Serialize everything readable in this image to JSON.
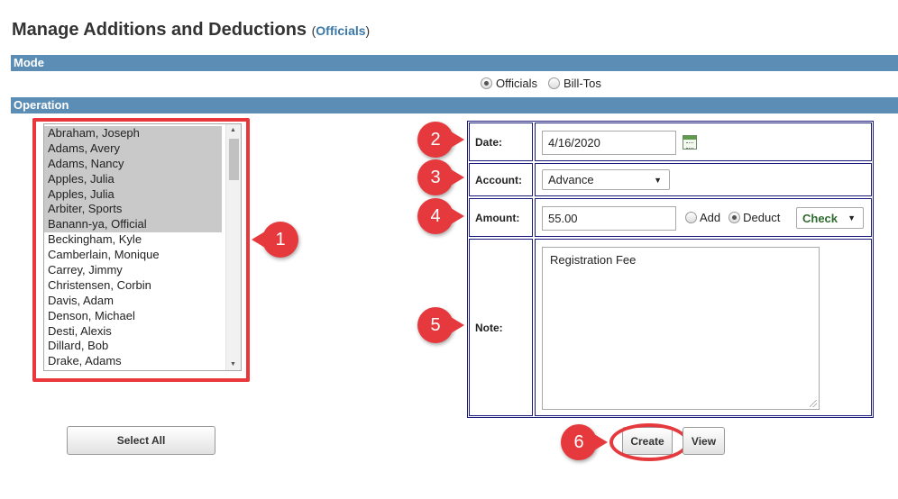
{
  "header": {
    "title": "Manage Additions and Deductions",
    "context_open": "(",
    "context_link": "Officials",
    "context_close": ")"
  },
  "mode": {
    "bar_label": "Mode",
    "options": [
      "Officials",
      "Bill-Tos"
    ],
    "selected": "Officials"
  },
  "operation": {
    "bar_label": "Operation"
  },
  "officials_list": {
    "items": [
      "Abraham, Joseph",
      "Adams, Avery",
      "Adams, Nancy",
      "Apples, Julia",
      "Apples, Julia",
      "Arbiter, Sports",
      "Banann-ya, Official",
      "Beckingham, Kyle",
      "Camberlain, Monique",
      "Carrey, Jimmy",
      "Christensen, Corbin",
      "Davis, Adam",
      "Denson, Michael",
      "Desti, Alexis",
      "Dillard, Bob",
      "Drake, Adams"
    ],
    "selected_count": 7
  },
  "buttons": {
    "select_all": "Select All",
    "create": "Create",
    "view": "View"
  },
  "form": {
    "date_label": "Date:",
    "date_value": "4/16/2020",
    "account_label": "Account:",
    "account_value": "Advance",
    "amount_label": "Amount:",
    "amount_value": "55.00",
    "add_label": "Add",
    "deduct_label": "Deduct",
    "type_value": "Check",
    "note_label": "Note:",
    "note_value": "Registration Fee"
  },
  "callouts": [
    "1",
    "2",
    "3",
    "4",
    "5",
    "6"
  ],
  "colors": {
    "bar": "#5b8db5",
    "callout": "#e5393d",
    "table_border": "#1a1a7a",
    "link": "#3a78a8",
    "check_text": "#2e6b2e"
  }
}
